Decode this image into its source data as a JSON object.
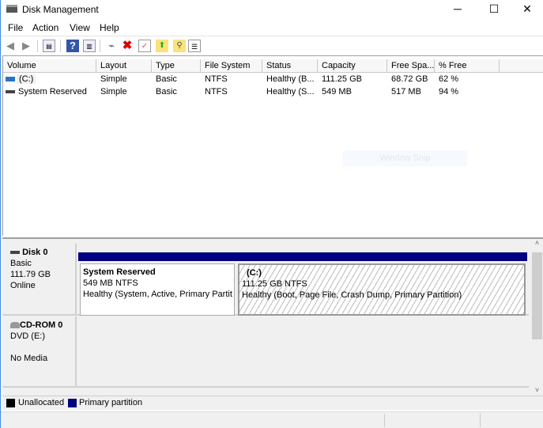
{
  "window": {
    "title": "Disk Management",
    "minimize": "─",
    "maximize": "☐",
    "close": "✕"
  },
  "menu": [
    "File",
    "Action",
    "View",
    "Help"
  ],
  "toolbar": {
    "icons": [
      "back-icon",
      "forward-icon",
      "console-tree-icon",
      "help-icon",
      "action-pane-icon",
      "connect-drive-icon",
      "delete-icon",
      "properties-icon",
      "folder-up-icon",
      "explore-icon",
      "settings-list-icon"
    ]
  },
  "columns": [
    "Volume",
    "Layout",
    "Type",
    "File System",
    "Status",
    "Capacity",
    "Free Spa...",
    "% Free"
  ],
  "rows": [
    [
      "(C:)",
      "Simple",
      "Basic",
      "NTFS",
      "Healthy (B...",
      "111.25 GB",
      "68.72 GB",
      "62 %"
    ],
    [
      "System Reserved",
      "Simple",
      "Basic",
      "NTFS",
      "Healthy (S...",
      "549 MB",
      "517 MB",
      "94 %"
    ]
  ],
  "overlay": "Window Snip",
  "disks": [
    {
      "name": "Disk 0",
      "type": "Basic",
      "size": "111.79 GB",
      "state": "Online",
      "partitions": [
        {
          "name": "System Reserved",
          "size": "549 MB NTFS",
          "status": "Healthy (System, Active, Primary Partit"
        },
        {
          "name": "(C:)",
          "size": "111.25 GB NTFS",
          "status": "Healthy (Boot, Page File, Crash Dump, Primary Partition)"
        }
      ]
    },
    {
      "name": "CD-ROM 0",
      "type": "DVD (E:)",
      "state": "No Media"
    }
  ],
  "legend": [
    {
      "label": "Unallocated",
      "color": "#000000"
    },
    {
      "label": "Primary partition",
      "color": "#000080"
    }
  ]
}
